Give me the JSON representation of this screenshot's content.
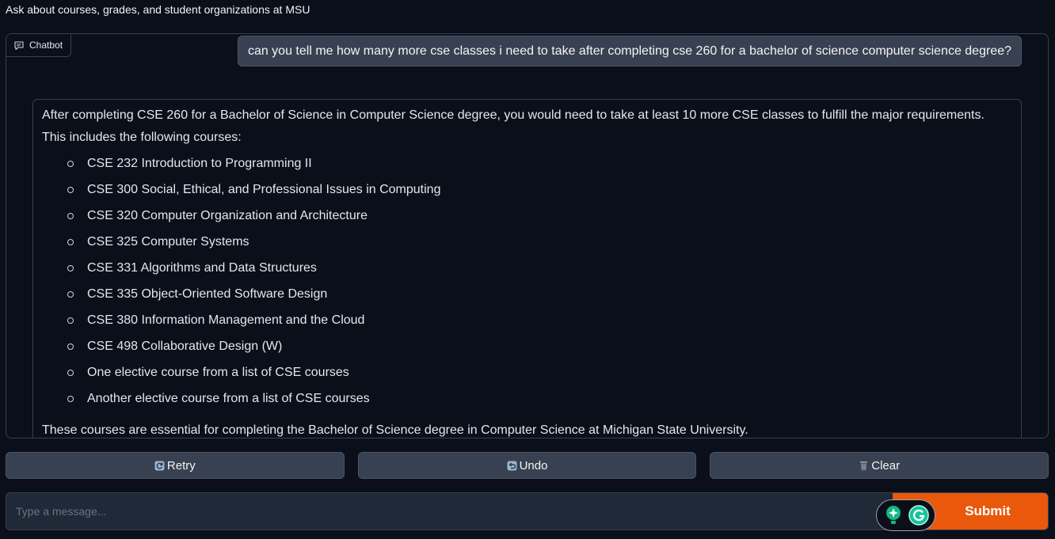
{
  "header": {
    "description": "Ask about courses, grades, and student organizations at MSU"
  },
  "chatbot": {
    "label": "Chatbot",
    "icon": "chat-bubble-icon",
    "user_message": "can you tell me how many more cse classes i need to take after completing cse 260 for a bachelor of science computer science degree?",
    "bot_message": {
      "intro": "After completing CSE 260 for a Bachelor of Science in Computer Science degree, you would need to take at least 10 more CSE classes to fulfill the major requirements. This includes the following courses:",
      "courses": [
        "CSE 232 Introduction to Programming II",
        "CSE 300 Social, Ethical, and Professional Issues in Computing",
        "CSE 320 Computer Organization and Architecture",
        "CSE 325 Computer Systems",
        "CSE 331 Algorithms and Data Structures",
        "CSE 335 Object-Oriented Software Design",
        "CSE 380 Information Management and the Cloud",
        "CSE 498 Collaborative Design (W)",
        "One elective course from a list of CSE courses",
        "Another elective course from a list of CSE courses"
      ],
      "outro": "These courses are essential for completing the Bachelor of Science degree in Computer Science at Michigan State University."
    }
  },
  "buttons": {
    "retry": {
      "label": "Retry",
      "icon": "retry-icon"
    },
    "undo": {
      "label": "Undo",
      "icon": "undo-icon"
    },
    "clear": {
      "label": "Clear",
      "icon": "trash-icon"
    }
  },
  "input": {
    "placeholder": "Type a message...",
    "value": "",
    "submit_label": "Submit"
  },
  "colors": {
    "background": "#0b0f19",
    "panel_border": "#374151",
    "button_bg": "#374151",
    "submit_bg": "#ea580c",
    "user_bubble": "#374151"
  }
}
